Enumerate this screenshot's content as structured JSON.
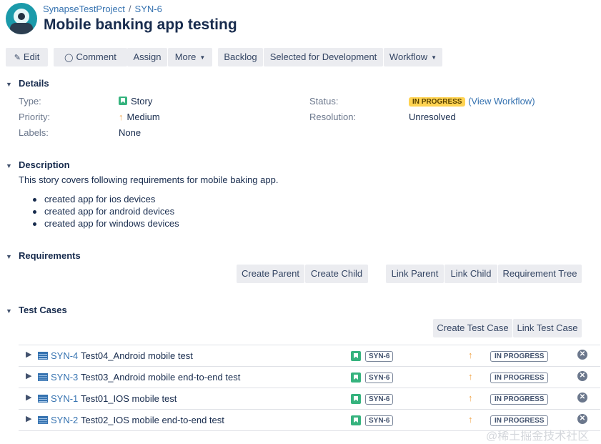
{
  "header": {
    "project": "SynapseTestProject",
    "separator": "/",
    "issue_key": "SYN-6",
    "title": "Mobile banking app testing"
  },
  "toolbar": {
    "edit": "Edit",
    "comment": "Comment",
    "assign": "Assign",
    "more": "More",
    "backlog": "Backlog",
    "selected_for_development": "Selected for Development",
    "workflow": "Workflow"
  },
  "details": {
    "heading": "Details",
    "type_label": "Type:",
    "type_value": "Story",
    "priority_label": "Priority:",
    "priority_value": "Medium",
    "labels_label": "Labels:",
    "labels_value": "None",
    "status_label": "Status:",
    "status_value": "IN PROGRESS",
    "view_workflow": "(View Workflow)",
    "resolution_label": "Resolution:",
    "resolution_value": "Unresolved"
  },
  "description": {
    "heading": "Description",
    "text": "This story covers following requirements for mobile baking app.",
    "bullets": [
      "created app for ios devices",
      "created app for android devices",
      "created app for windows devices"
    ]
  },
  "requirements": {
    "heading": "Requirements",
    "create_parent": "Create Parent",
    "create_child": "Create Child",
    "link_parent": "Link Parent",
    "link_child": "Link Child",
    "requirement_tree": "Requirement Tree"
  },
  "test_cases": {
    "heading": "Test Cases",
    "create_test_case": "Create Test Case",
    "link_test_case": "Link Test Case",
    "rows": [
      {
        "key": "SYN-4",
        "summary": "Test04_Android mobile test",
        "parent": "SYN-6",
        "status": "IN PROGRESS"
      },
      {
        "key": "SYN-3",
        "summary": "Test03_Android mobile end-to-end test",
        "parent": "SYN-6",
        "status": "IN PROGRESS"
      },
      {
        "key": "SYN-1",
        "summary": "Test01_IOS mobile test",
        "parent": "SYN-6",
        "status": "IN PROGRESS"
      },
      {
        "key": "SYN-2",
        "summary": "Test02_IOS mobile end-to-end test",
        "parent": "SYN-6",
        "status": "IN PROGRESS"
      }
    ]
  },
  "watermark": "@稀土掘金技术社区",
  "icons": {
    "edit": "pencil-icon",
    "comment": "speech-bubble-icon",
    "collapse": "chevron-down-icon",
    "expand": "chevron-right-icon",
    "story": "story-bookmark-icon",
    "priority": "arrow-up-icon",
    "test_case": "test-case-icon",
    "remove": "remove-x-icon"
  },
  "colors": {
    "link": "#3572b0",
    "status_in_progress": "#ffd351",
    "story_icon": "#36b37e",
    "priority_medium": "#f0a447",
    "button_bg": "#ebecf0"
  }
}
